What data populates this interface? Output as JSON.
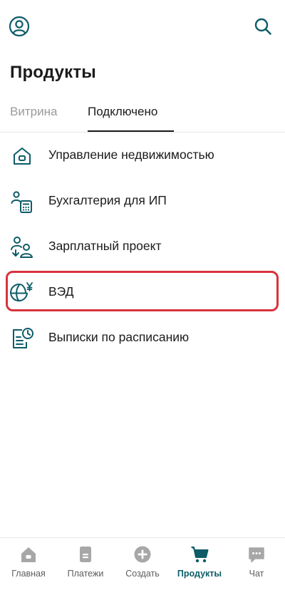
{
  "header": {
    "profile_icon": "user-circle-icon",
    "search_icon": "search-icon",
    "title": "Продукты"
  },
  "tabs": [
    {
      "label": "Витрина",
      "active": false
    },
    {
      "label": "Подключено",
      "active": true
    }
  ],
  "products": [
    {
      "label": "Управление недвижимостью",
      "icon": "house-icon"
    },
    {
      "label": "Бухгалтерия для ИП",
      "icon": "accounting-person-calculator-icon"
    },
    {
      "label": "Зарплатный проект",
      "icon": "salary-people-icon"
    },
    {
      "label": "ВЭД",
      "icon": "globe-yen-icon",
      "highlighted": true
    },
    {
      "label": "Выписки по расписанию",
      "icon": "scheduled-statement-icon"
    }
  ],
  "bottom_nav": [
    {
      "label": "Главная",
      "icon": "home-icon",
      "active": false
    },
    {
      "label": "Платежи",
      "icon": "payments-icon",
      "active": false
    },
    {
      "label": "Создать",
      "icon": "plus-circle-icon",
      "active": false
    },
    {
      "label": "Продукты",
      "icon": "cart-icon",
      "active": true
    },
    {
      "label": "Чат",
      "icon": "chat-icon",
      "active": false
    }
  ],
  "colors": {
    "accent": "#0d5c68",
    "highlight_border": "#d8323c",
    "inactive_tab": "#9a9a9a",
    "nav_inactive_icon": "#a7a7a7"
  }
}
